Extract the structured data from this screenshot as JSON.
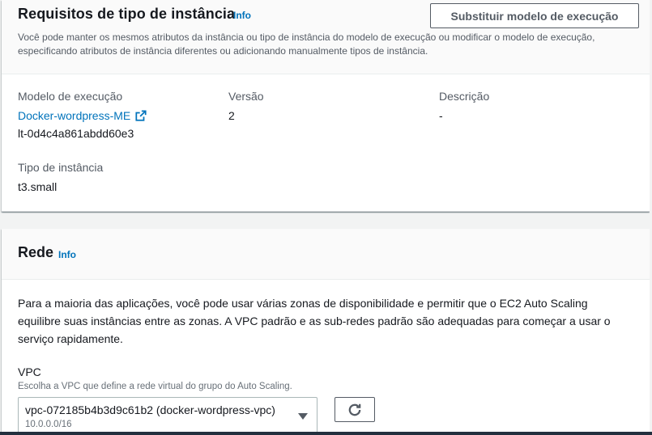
{
  "instance_section": {
    "title": "Requisitos de tipo de instância",
    "info": "Info",
    "replace_button": "Substituir modelo de execução",
    "description": "Você pode manter os mesmos atributos da instância ou tipo de instância do modelo de execução ou modificar o modelo de execução, especificando atributos de instância diferentes ou adicionando manualmente tipos de instância.",
    "template_label": "Modelo de execução",
    "template_name": "Docker-wordpress-ME",
    "template_id": "lt-0d4c4a861abdd60e3",
    "version_label": "Versão",
    "version_value": "2",
    "description_label": "Descrição",
    "description_value": "-",
    "instance_type_label": "Tipo de instância",
    "instance_type_value": "t3.small"
  },
  "network_section": {
    "title": "Rede",
    "info": "Info",
    "description": "Para a maioria das aplicações, você pode usar várias zonas de disponibilidade e permitir que o EC2 Auto Scaling equilibre suas instâncias entre as zonas. A VPC padrão e as sub-redes padrão são adequadas para começar a usar o serviço rapidamente.",
    "vpc_label": "VPC",
    "vpc_hint": "Escolha a VPC que define a rede virtual do grupo do Auto Scaling.",
    "vpc_selected": "vpc-072185b4b3d9c61b2 (docker-wordpress-vpc)",
    "vpc_cidr": "10.0.0.0/16"
  },
  "icons": {
    "external_link": "external-link-icon",
    "refresh": "refresh-icon",
    "dropdown": "caret-down-icon"
  },
  "colors": {
    "link": "#0073bb",
    "text": "#16191f",
    "muted": "#545b64",
    "background": "#f2f3f3"
  }
}
